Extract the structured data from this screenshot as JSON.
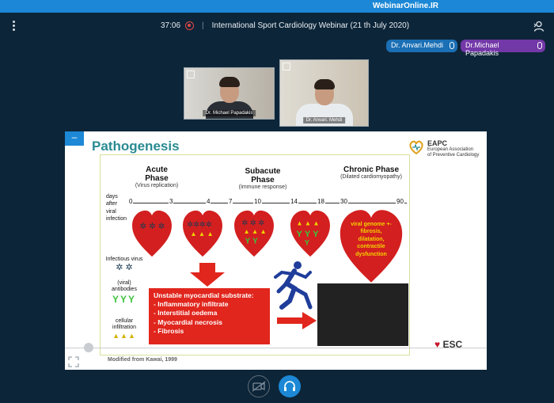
{
  "topbar": {
    "site": "WebinarOnline.IR"
  },
  "header": {
    "timer": "37:06",
    "separator": "|",
    "title": "International Sport Cardiology Webinar (21 th July 2020)"
  },
  "participants": [
    {
      "name": "Dr. Anvari.Mehdi",
      "color": "#1a6fb5"
    },
    {
      "name": "Dr.Michael Papadakis",
      "color": "#7338a8"
    }
  ],
  "videos": [
    {
      "label": "Dr. Michael Papadakis"
    },
    {
      "label": "Dr. Anvari. Mehdi"
    }
  ],
  "slide": {
    "title": "Pathogenesis",
    "org_abbr": "EAPC",
    "org_line1": "European Association",
    "org_line2": "of Preventive Cardiology",
    "phases": [
      {
        "name": "Acute Phase",
        "sub": "(Virus replication)"
      },
      {
        "name": "Subacute Phase",
        "sub": "(Immune response)"
      },
      {
        "name": "Chronic Phase",
        "sub": "(Dilated cardiomyopathy)"
      }
    ],
    "days_label": [
      "days",
      "after",
      "viral",
      "infection"
    ],
    "ticks": [
      "0",
      "3",
      "4",
      "7",
      "10",
      "14",
      "18",
      "30",
      "90"
    ],
    "legend": {
      "virus": "Infectious virus",
      "antibodies": "(viral) antibodies",
      "cellular": "cellular infiltration"
    },
    "chronic_heart_text": [
      "viral genome +-",
      "fibrosis,",
      "dilatation,",
      "contractile",
      "dysfunction"
    ],
    "unstable_lines": [
      "Unstable myocardial substrate:",
      "- Inflammatory infiltrate",
      "- Interstitial oedema",
      "- Myocardial necrosis",
      "- Fibrosis"
    ],
    "source": "Modified from Kawai, 1999",
    "esc": "ESC"
  },
  "colors": {
    "accent": "#1c88d6",
    "title": "#2a8b92",
    "red": "#e0261d"
  }
}
